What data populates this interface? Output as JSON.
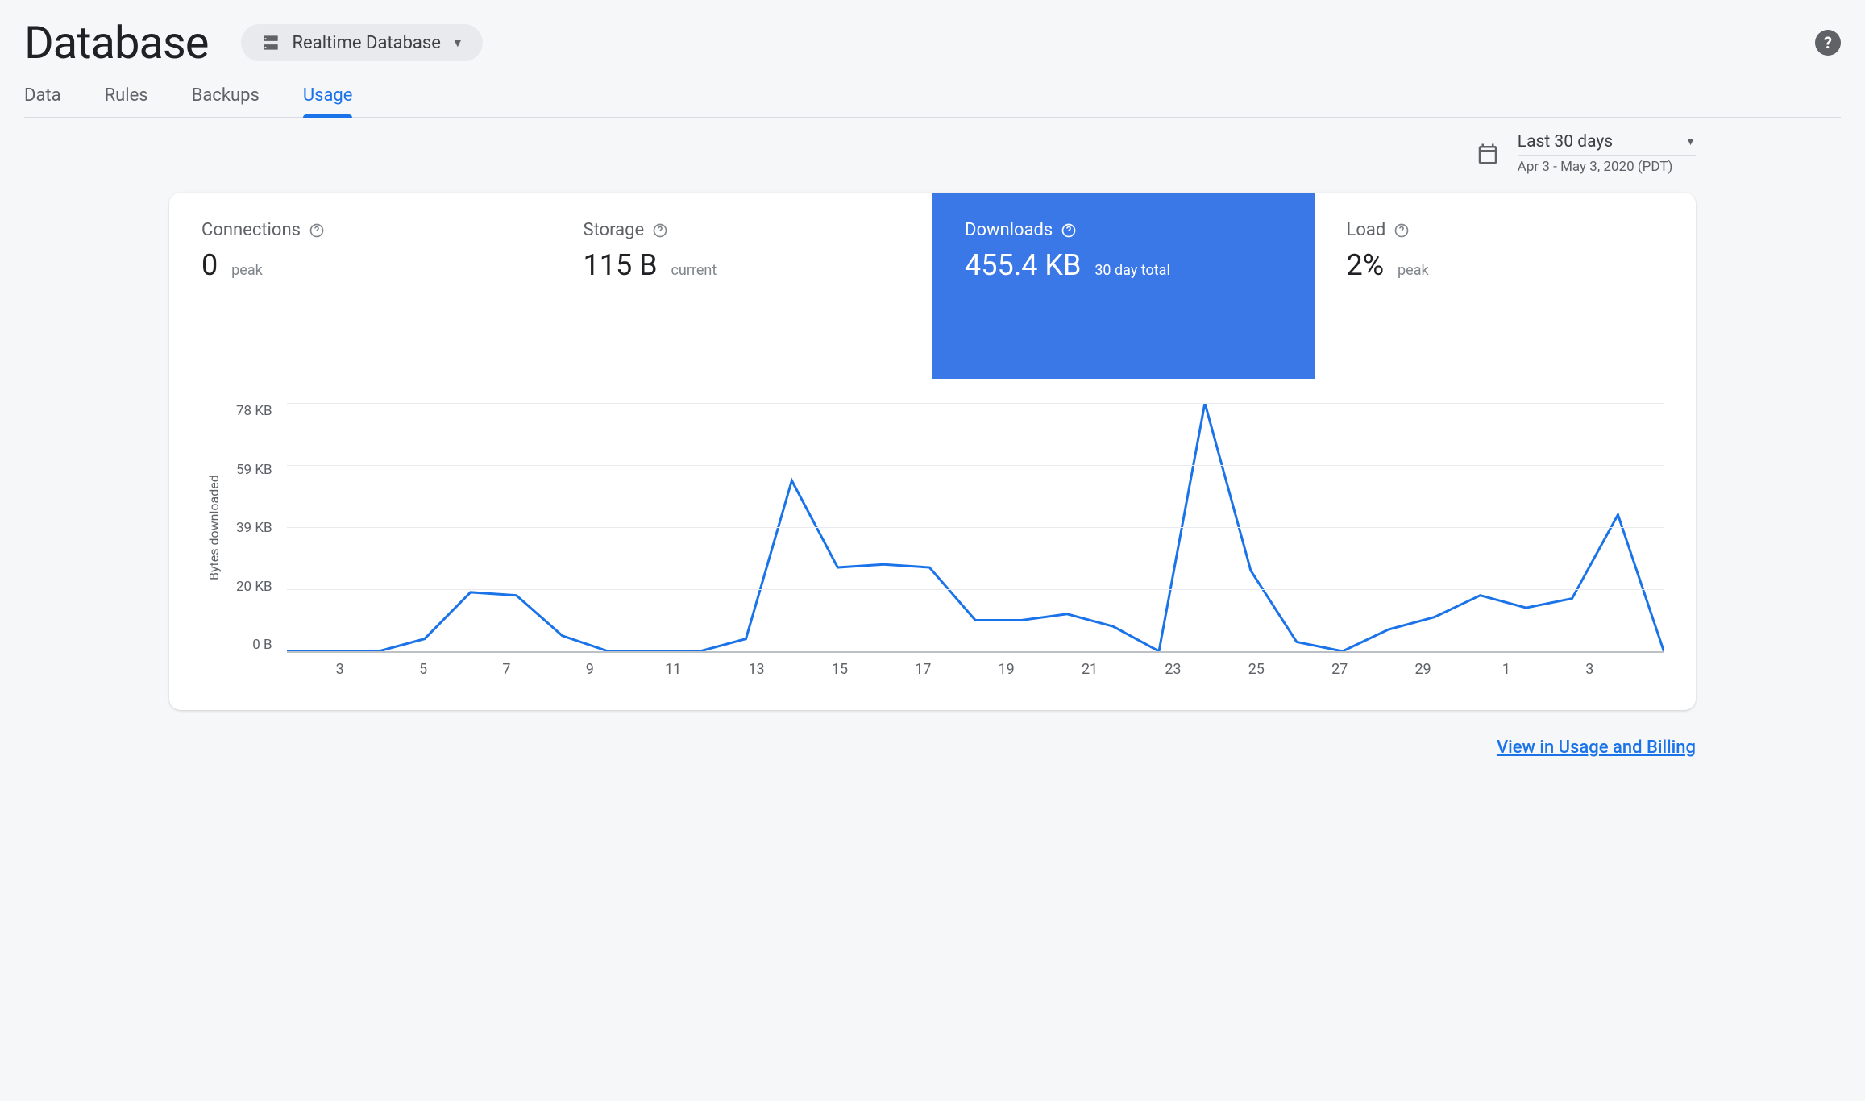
{
  "header": {
    "title": "Database",
    "selector_label": "Realtime Database"
  },
  "tabs": [
    "Data",
    "Rules",
    "Backups",
    "Usage"
  ],
  "active_tab": "Usage",
  "date": {
    "range_label": "Last 30 days",
    "range_detail": "Apr 3 - May 3, 2020 (PDT)"
  },
  "metrics": {
    "connections": {
      "title": "Connections",
      "value": "0",
      "sub": "peak"
    },
    "storage": {
      "title": "Storage",
      "value": "115 B",
      "sub": "current"
    },
    "downloads": {
      "title": "Downloads",
      "value": "455.4 KB",
      "sub": "30 day total"
    },
    "load": {
      "title": "Load",
      "value": "2%",
      "sub": "peak"
    }
  },
  "chart_data": {
    "type": "line",
    "title": "",
    "ylabel": "Bytes downloaded",
    "xlabel": "",
    "ylim": [
      0,
      80
    ],
    "y_ticks": [
      "78 KB",
      "59 KB",
      "39 KB",
      "20 KB",
      "0 B"
    ],
    "x_ticks": [
      "3",
      "5",
      "7",
      "9",
      "11",
      "13",
      "15",
      "17",
      "19",
      "21",
      "23",
      "25",
      "27",
      "29",
      "1",
      "3"
    ],
    "x": [
      3,
      4,
      5,
      6,
      7,
      8,
      9,
      10,
      11,
      12,
      13,
      14,
      15,
      16,
      17,
      18,
      19,
      20,
      21,
      22,
      23,
      24,
      25,
      26,
      27,
      28,
      29,
      30,
      1,
      2,
      3
    ],
    "values": [
      0,
      0,
      0,
      4,
      19,
      18,
      5,
      0,
      0,
      0,
      4,
      55,
      27,
      28,
      27,
      10,
      10,
      12,
      8,
      0,
      80,
      26,
      3,
      0,
      7,
      11,
      18,
      14,
      17,
      44,
      0
    ],
    "series_name": "Downloads (KB)"
  },
  "footer": {
    "link_label": "View in Usage and Billing"
  }
}
